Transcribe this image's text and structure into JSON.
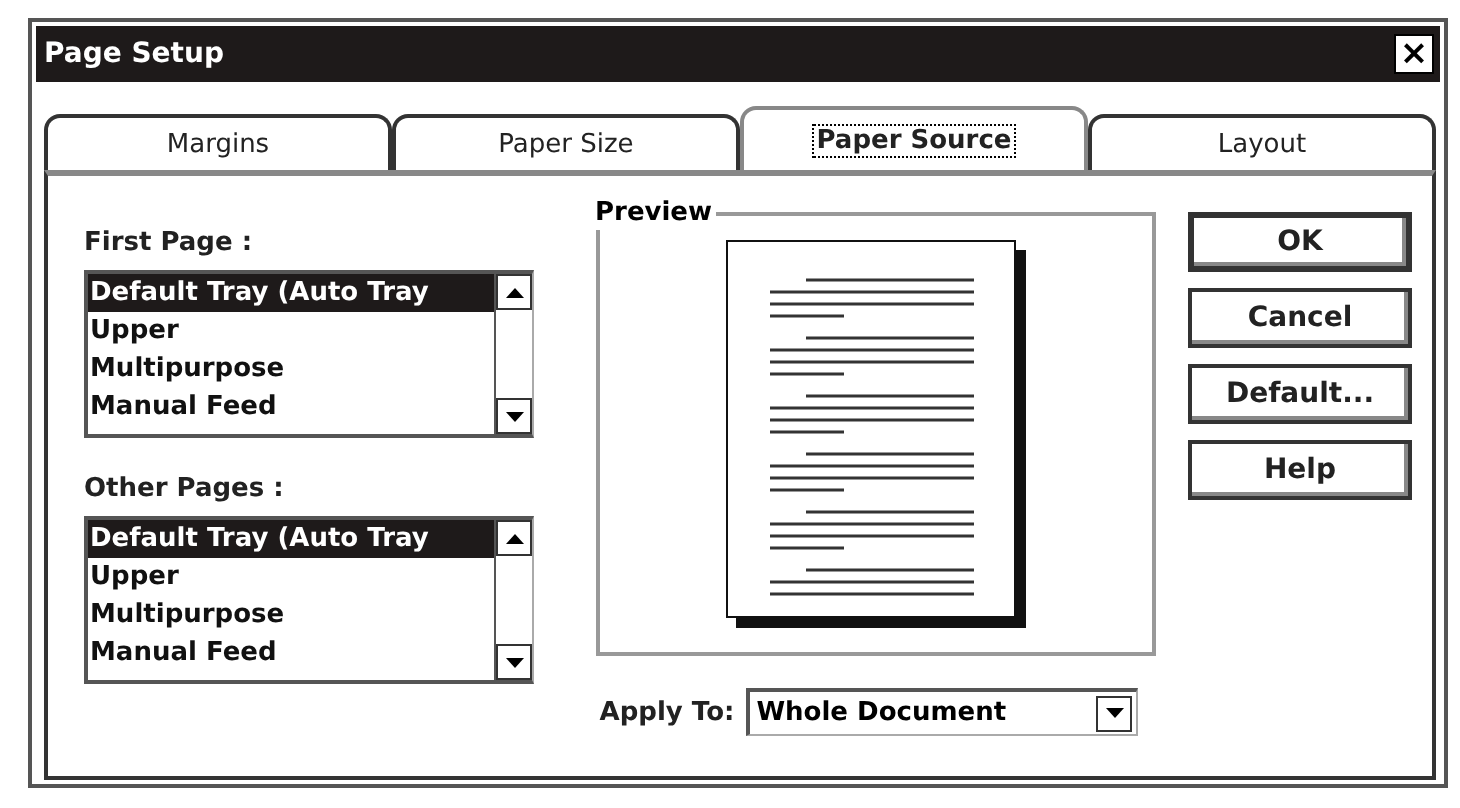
{
  "window": {
    "title": "Page Setup",
    "close": "×"
  },
  "tabs": [
    {
      "label": "Margins",
      "selected": false
    },
    {
      "label": "Paper Size",
      "selected": false
    },
    {
      "label": "Paper Source",
      "selected": true
    },
    {
      "label": "Layout",
      "selected": false
    }
  ],
  "lists": [
    {
      "label": "First Page :",
      "items": [
        {
          "text": "Default Tray (Auto Tray",
          "selected": true
        },
        {
          "text": "Upper",
          "selected": false
        },
        {
          "text": "Multipurpose",
          "selected": false
        },
        {
          "text": "Manual Feed",
          "selected": false
        }
      ]
    },
    {
      "label": "Other Pages :",
      "items": [
        {
          "text": "Default Tray (Auto Tray",
          "selected": true
        },
        {
          "text": "Upper",
          "selected": false
        },
        {
          "text": "Multipurpose",
          "selected": false
        },
        {
          "text": "Manual Feed",
          "selected": false
        }
      ]
    }
  ],
  "preview": {
    "label": "Preview"
  },
  "apply_to": {
    "label": "Apply To:",
    "value": "Whole Document"
  },
  "buttons": [
    {
      "label": "OK",
      "default": true
    },
    {
      "label": "Cancel",
      "default": false
    },
    {
      "label": "Default...",
      "default": false
    },
    {
      "label": "Help",
      "default": false
    }
  ]
}
